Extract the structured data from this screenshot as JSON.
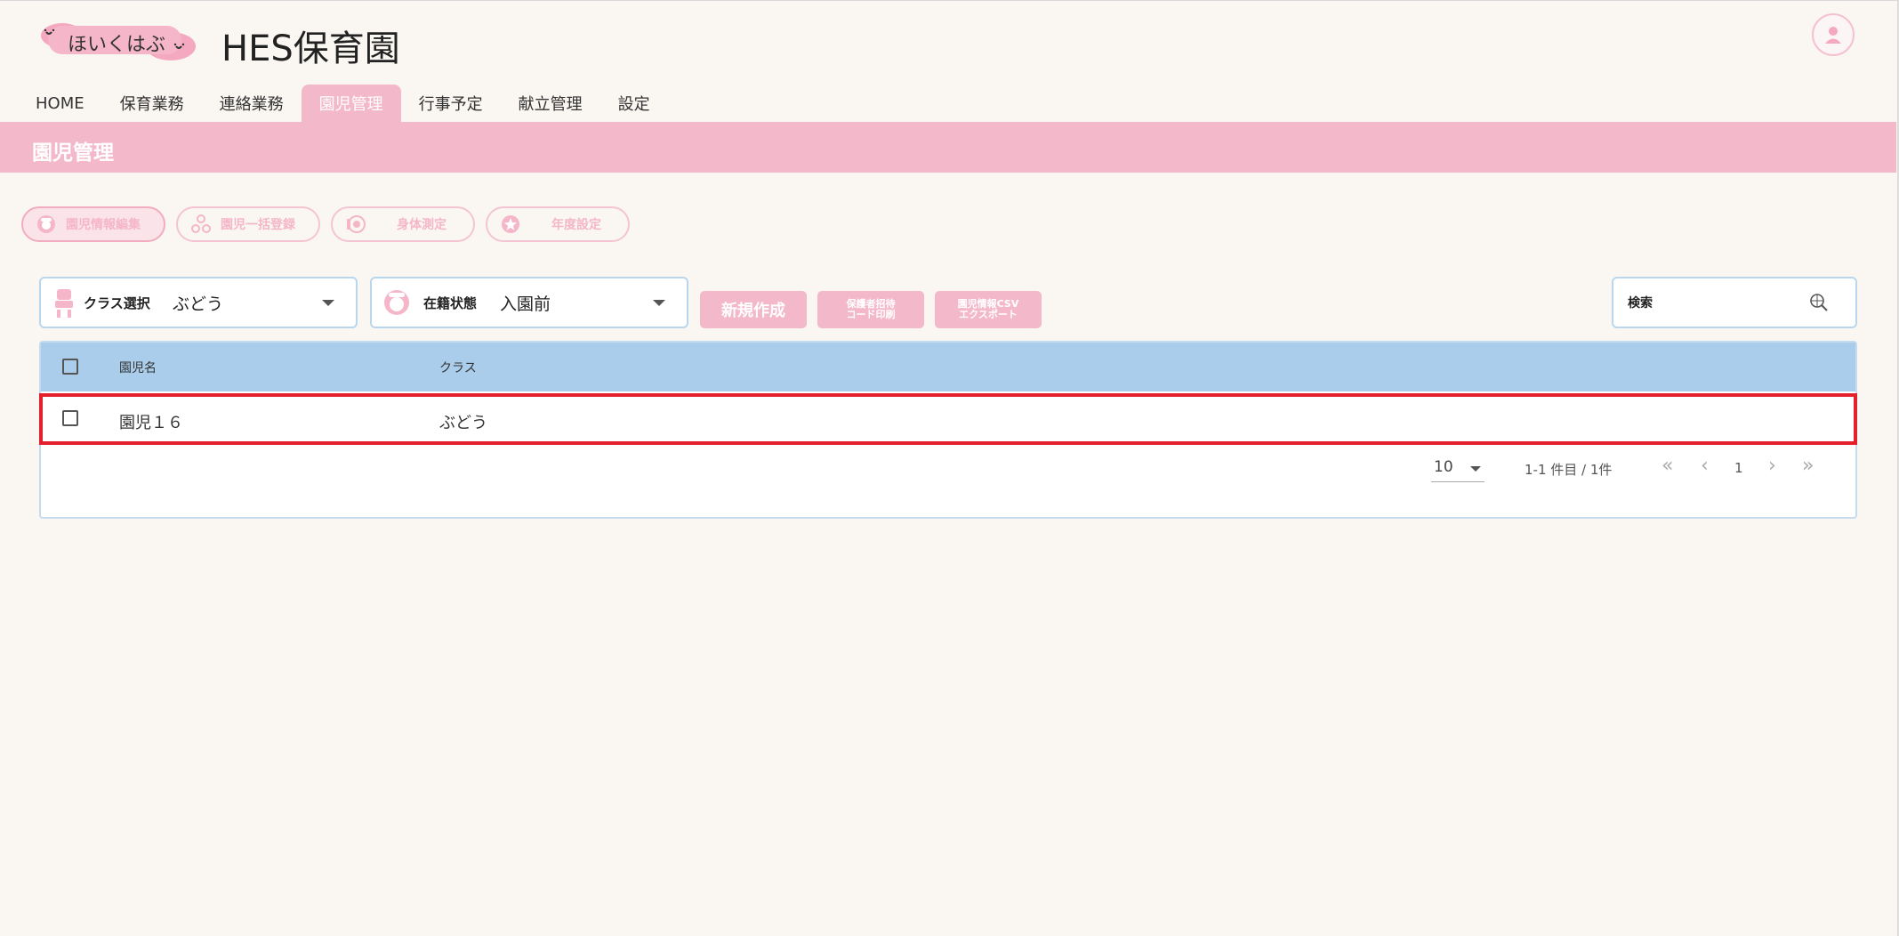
{
  "app": {
    "logo_text": "ほいくはぶ",
    "title": "HES保育園"
  },
  "nav": {
    "items": [
      {
        "label": "HOME",
        "active": false
      },
      {
        "label": "保育業務",
        "active": false
      },
      {
        "label": "連絡業務",
        "active": false
      },
      {
        "label": "園児管理",
        "active": true
      },
      {
        "label": "行事予定",
        "active": false
      },
      {
        "label": "献立管理",
        "active": false
      },
      {
        "label": "設定",
        "active": false
      }
    ]
  },
  "section": {
    "title": "園児管理"
  },
  "tools": [
    {
      "label": "園児情報編集",
      "icon": "child-icon",
      "active": true
    },
    {
      "label": "園児一括登録",
      "icon": "group-icon",
      "active": false
    },
    {
      "label": "身体測定",
      "icon": "measure-icon",
      "active": false
    },
    {
      "label": "年度設定",
      "icon": "star-icon",
      "active": false
    }
  ],
  "filters": {
    "class_select": {
      "label": "クラス選択",
      "value": "ぶどう"
    },
    "enrollment": {
      "label": "在籍状態",
      "value": "入園前"
    }
  },
  "actions": {
    "new_label": "新規作成",
    "print_line1": "保護者招待",
    "print_line2": "コード印刷",
    "export_line1": "園児情報CSV",
    "export_line2": "エクスポート"
  },
  "search": {
    "placeholder": "検索"
  },
  "table": {
    "headers": {
      "name": "園児名",
      "class": "クラス"
    },
    "rows": [
      {
        "name": "園児１６",
        "class": "ぶどう"
      }
    ]
  },
  "pagination": {
    "page_size": "10",
    "range_text": "1-1 件目 / 1件",
    "current_page": "1"
  },
  "colors": {
    "accent_pink": "#f4b8cb",
    "header_blue": "#a9cdea",
    "highlight_red": "#e3202c"
  }
}
